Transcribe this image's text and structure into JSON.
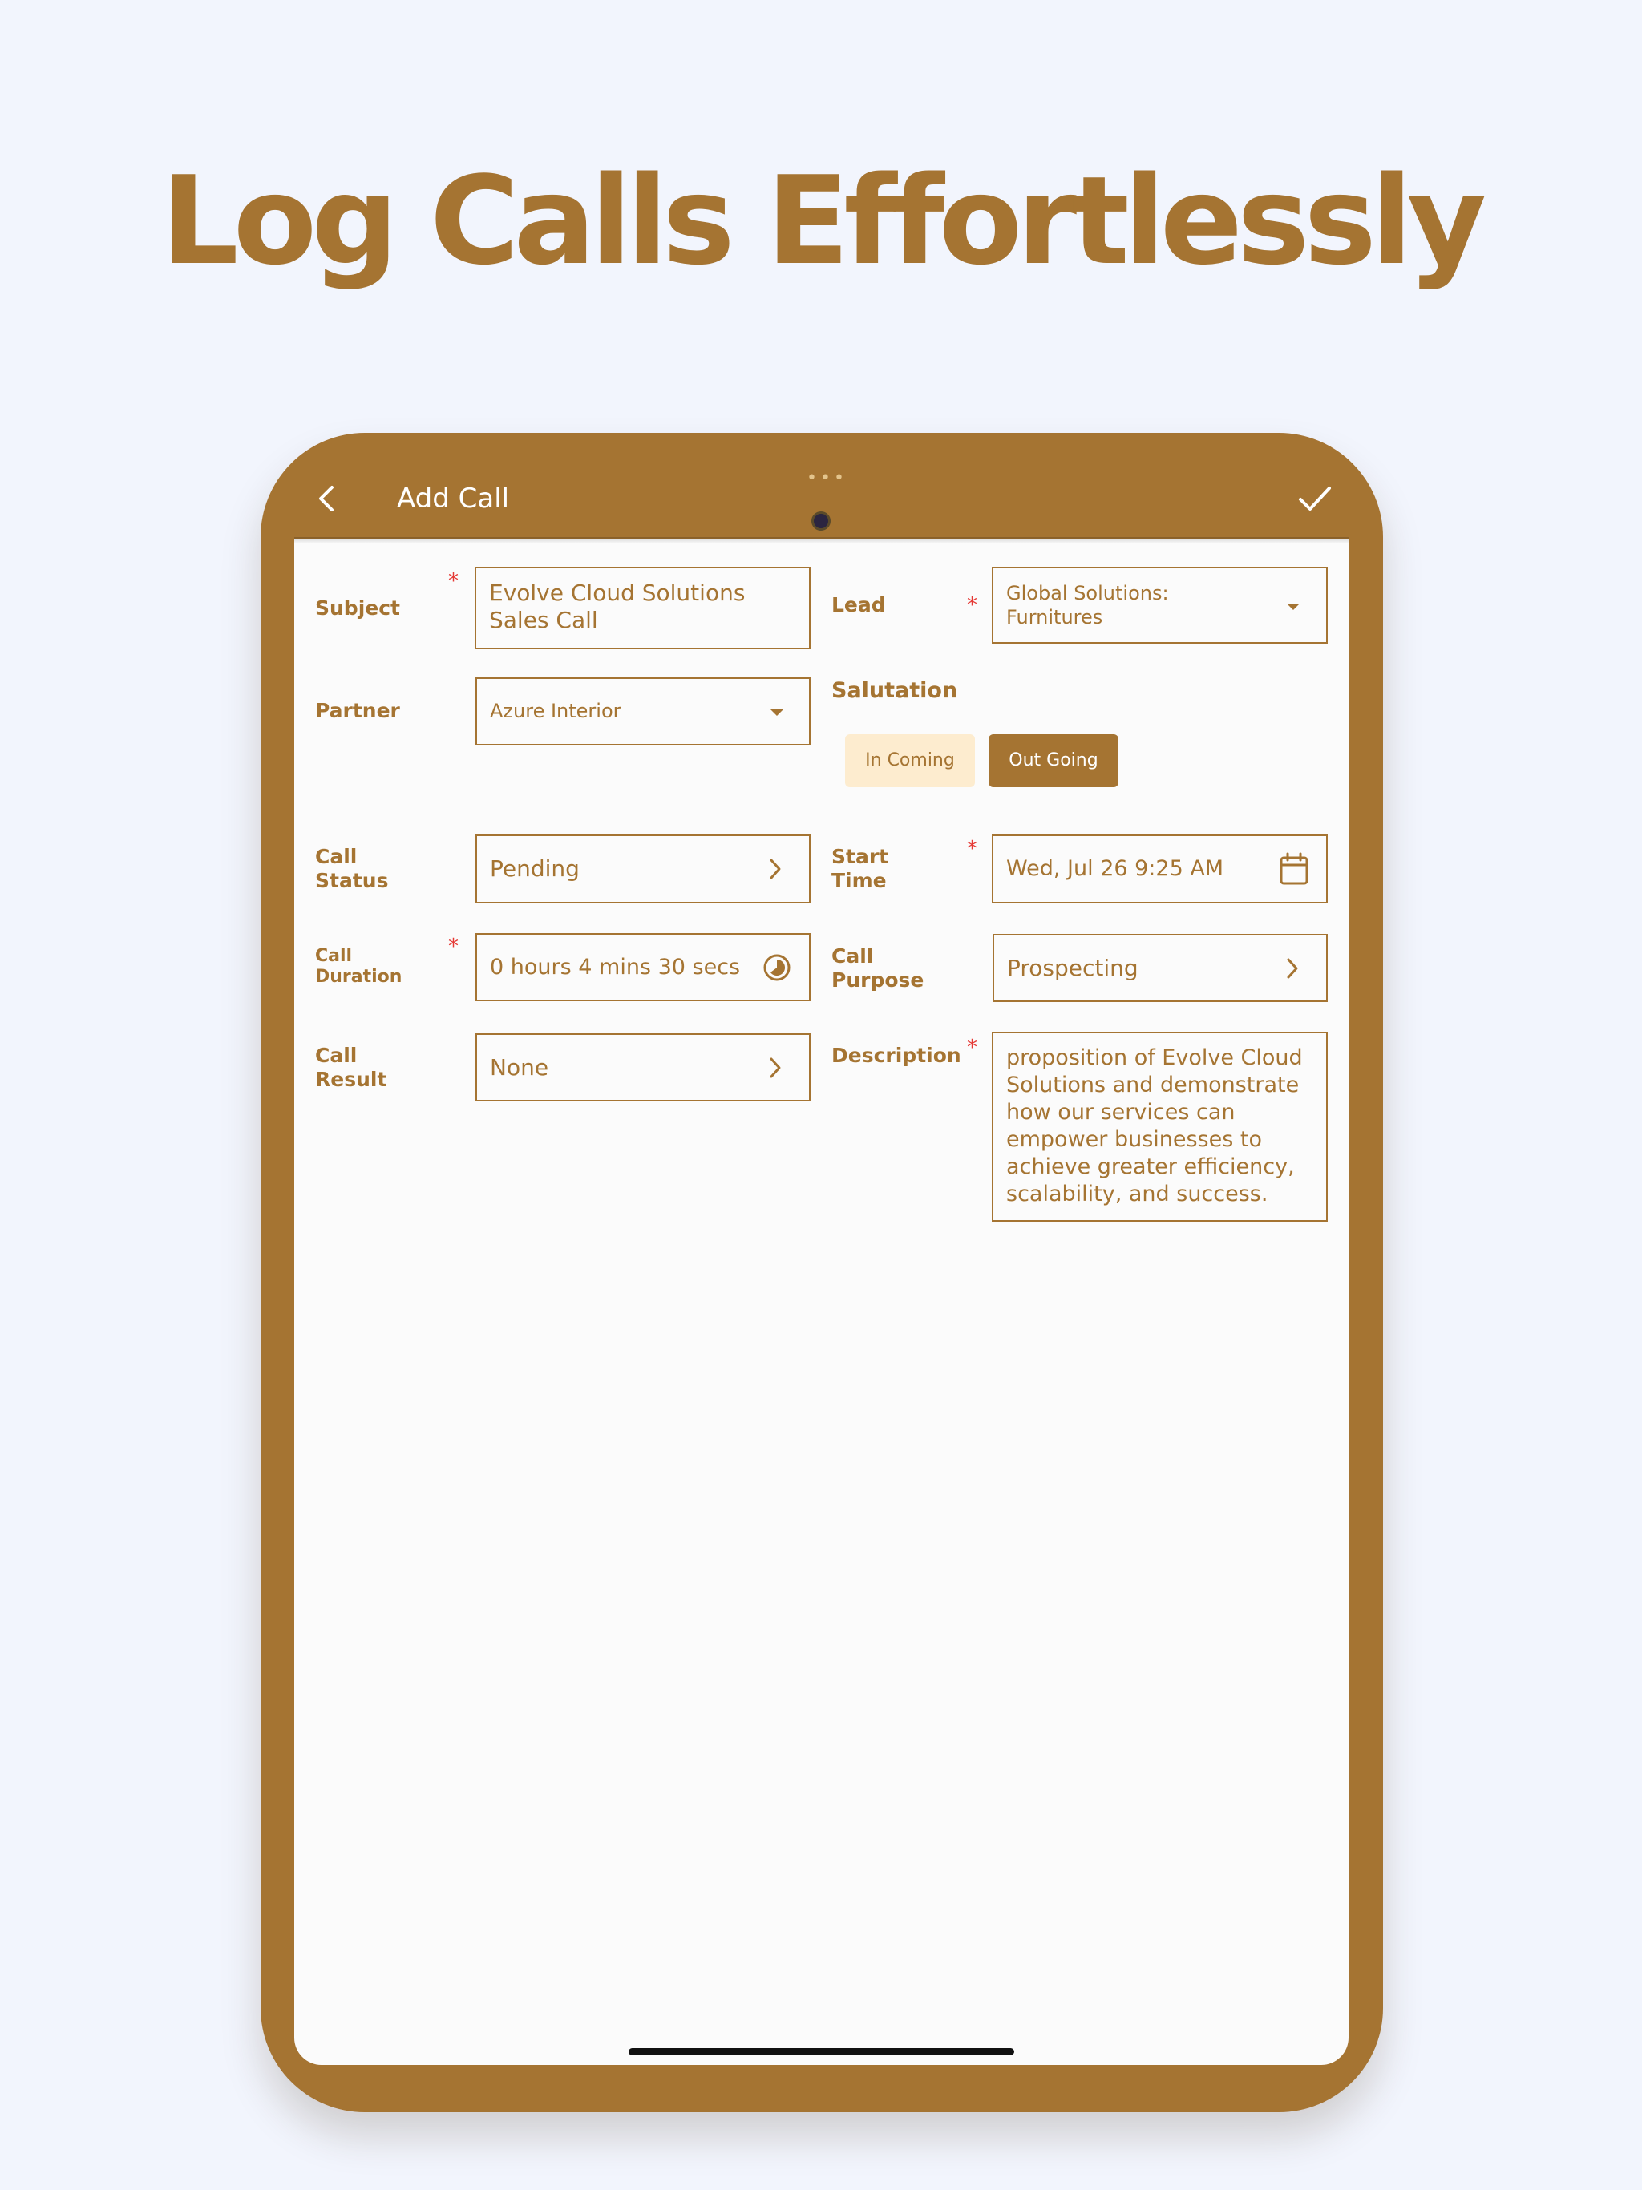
{
  "headline": "Log Calls Effortlessly",
  "appbar": {
    "title": "Add Call",
    "back_icon": "chevron-left-icon",
    "save_icon": "check-icon"
  },
  "colors": {
    "brand": "#a57432",
    "background": "#f2f5fd",
    "screen": "#fbfbfb",
    "required": "#e53935",
    "segment_inactive_bg": "#fdeccf"
  },
  "form": {
    "subject": {
      "label": "Subject",
      "required": true,
      "value_line1": "Evolve Cloud Solutions",
      "value_line2": "Sales Call"
    },
    "lead": {
      "label": "Lead",
      "required": true,
      "value_line1": "Global Solutions:",
      "value_line2": "Furnitures",
      "icon": "dropdown-arrow-icon"
    },
    "partner": {
      "label": "Partner",
      "value": "Azure Interior",
      "icon": "dropdown-arrow-icon"
    },
    "salutation": {
      "label": "Salutation",
      "options": [
        "In Coming",
        "Out Going"
      ],
      "selected": "Out Going"
    },
    "call_status": {
      "label_line1": "Call",
      "label_line2": "Status",
      "value": "Pending",
      "icon": "chevron-right-icon"
    },
    "start_time": {
      "label_line1": "Start",
      "label_line2": "Time",
      "required": true,
      "value": "Wed, Jul 26 9:25 AM",
      "icon": "calendar-icon"
    },
    "call_duration": {
      "label_line1": "Call",
      "label_line2": "Duration",
      "required": true,
      "value": "0 hours 4 mins 30 secs",
      "icon": "timer-icon"
    },
    "call_purpose": {
      "label_line1": "Call",
      "label_line2": "Purpose",
      "value": "Prospecting",
      "icon": "chevron-right-icon"
    },
    "call_result": {
      "label_line1": "Call",
      "label_line2": "Result",
      "value": "None",
      "icon": "chevron-right-icon"
    },
    "description": {
      "label": "Description",
      "required": true,
      "lines": [
        "proposition of Evolve Cloud",
        "Solutions and demonstrate",
        "how our services can",
        "empower businesses to",
        "achieve greater efficiency,",
        "scalability, and success."
      ]
    }
  }
}
